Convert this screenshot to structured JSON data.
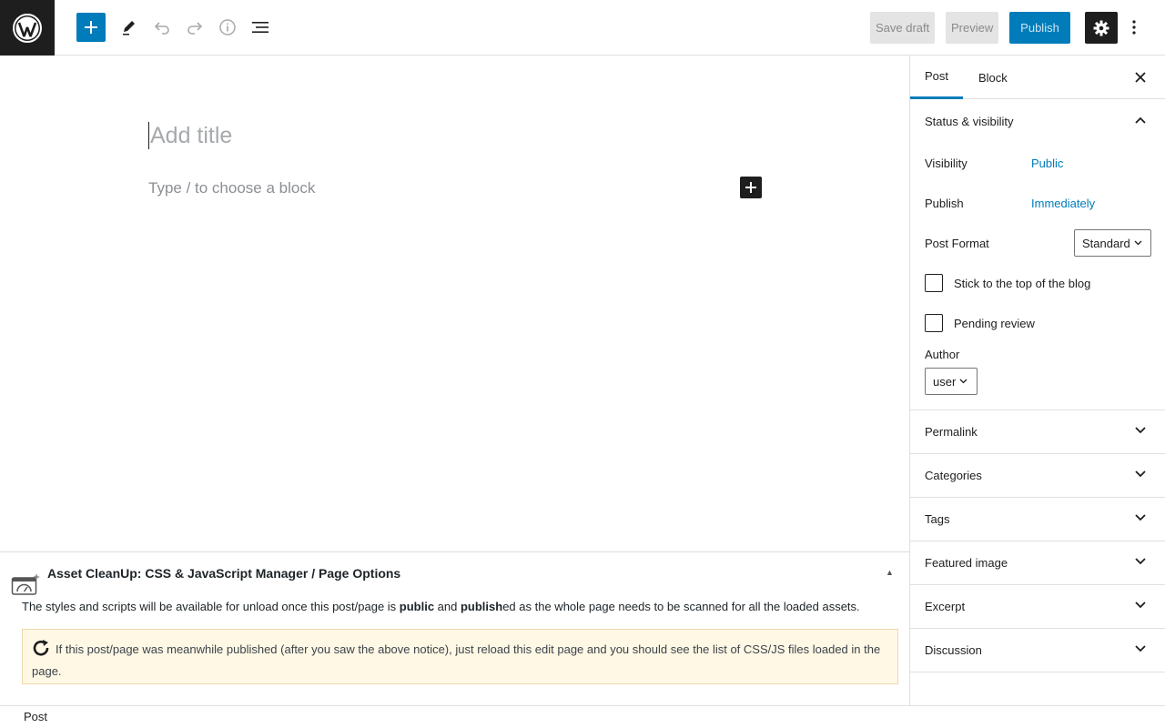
{
  "toolbar": {
    "save_draft": "Save draft",
    "preview": "Preview",
    "publish": "Publish"
  },
  "editor": {
    "title_placeholder": "Add title",
    "block_placeholder": "Type / to choose a block"
  },
  "metabox": {
    "title": "Asset CleanUp: CSS & JavaScript Manager / Page Options",
    "desc_1": "The styles and scripts will be available for unload once this post/page is ",
    "desc_bold_1": "public",
    "desc_2": " and ",
    "desc_bold_2": "publish",
    "desc_3": "ed as the whole page needs to be scanned for all the loaded assets.",
    "notice": "If this post/page was meanwhile published (after you saw the above notice), just reload this edit page and you should see the list of CSS/JS files loaded in the page."
  },
  "footer": {
    "breadcrumb": "Post"
  },
  "sidebar": {
    "tabs": [
      "Post",
      "Block"
    ],
    "status_panel": "Status & visibility",
    "visibility_label": "Visibility",
    "visibility_value": "Public",
    "publish_label": "Publish",
    "publish_value": "Immediately",
    "format_label": "Post Format",
    "format_value": "Standard",
    "sticky_label": "Stick to the top of the blog",
    "pending_label": "Pending review",
    "author_label": "Author",
    "author_value": "user",
    "panels": [
      "Permalink",
      "Categories",
      "Tags",
      "Featured image",
      "Excerpt",
      "Discussion"
    ]
  },
  "colors": {
    "accent": "#007cba",
    "dark": "#1e1e1e",
    "notice_bg": "#fff8e5"
  }
}
